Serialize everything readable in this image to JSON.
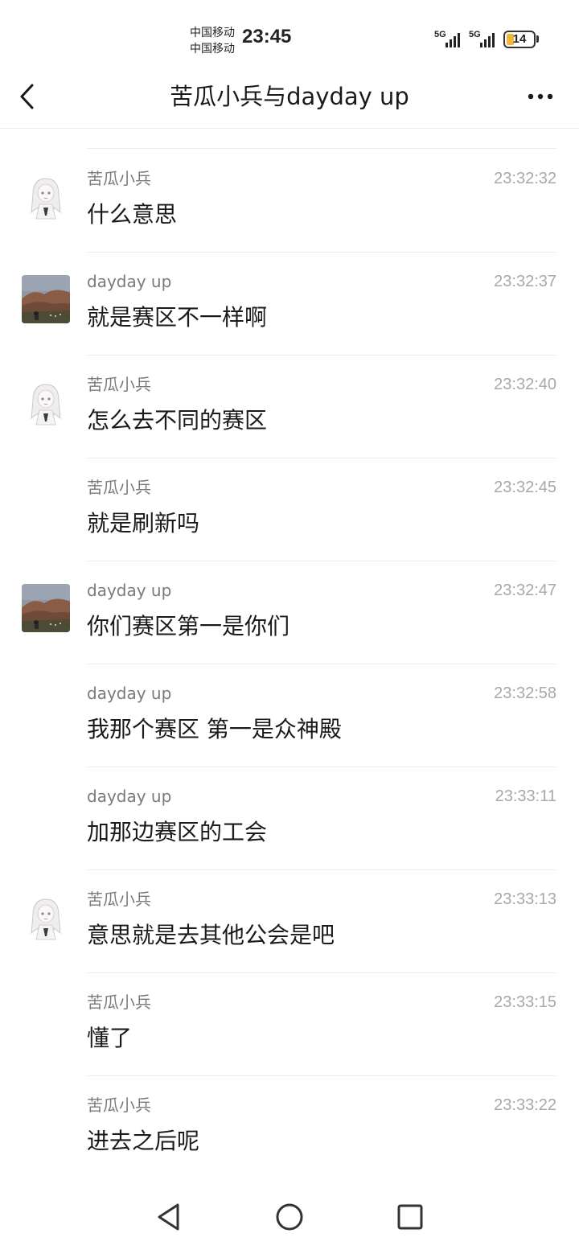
{
  "status_bar": {
    "carrier_1": "中国移动",
    "carrier_2": "中国移动",
    "time": "23:45",
    "signal_1_label": "5G",
    "signal_2_label": "5G",
    "battery": "14",
    "battery_level_percent": 14,
    "battery_color": "#f0b83a"
  },
  "header": {
    "back_icon": "chevron-left-icon",
    "title": "苦瓜小兵与dayday up",
    "more_icon": "more-horizontal-icon"
  },
  "messages": [
    {
      "sender": "苦瓜小兵",
      "time": "23:32:32",
      "text": "什么意思",
      "avatar": "anime-girl"
    },
    {
      "sender": "dayday up",
      "time": "23:32:37",
      "text": "就是赛区不一样啊",
      "avatar": "landscape"
    },
    {
      "sender": "苦瓜小兵",
      "time": "23:32:40",
      "text": "怎么去不同的赛区",
      "avatar": "anime-girl"
    },
    {
      "sender": "苦瓜小兵",
      "time": "23:32:45",
      "text": "就是刷新吗",
      "avatar": ""
    },
    {
      "sender": "dayday up",
      "time": "23:32:47",
      "text": "你们赛区第一是你们",
      "avatar": "landscape"
    },
    {
      "sender": "dayday up",
      "time": "23:32:58",
      "text": "我那个赛区 第一是众神殿",
      "avatar": ""
    },
    {
      "sender": "dayday up",
      "time": "23:33:11",
      "text": "加那边赛区的工会",
      "avatar": ""
    },
    {
      "sender": "苦瓜小兵",
      "time": "23:33:13",
      "text": "意思就是去其他公会是吧",
      "avatar": "anime-girl"
    },
    {
      "sender": "苦瓜小兵",
      "time": "23:33:15",
      "text": "懂了",
      "avatar": ""
    },
    {
      "sender": "苦瓜小兵",
      "time": "23:33:22",
      "text": "进去之后呢",
      "avatar": ""
    }
  ],
  "system_nav": {
    "back_icon": "triangle-back-icon",
    "home_icon": "circle-home-icon",
    "recents_icon": "square-recents-icon"
  }
}
